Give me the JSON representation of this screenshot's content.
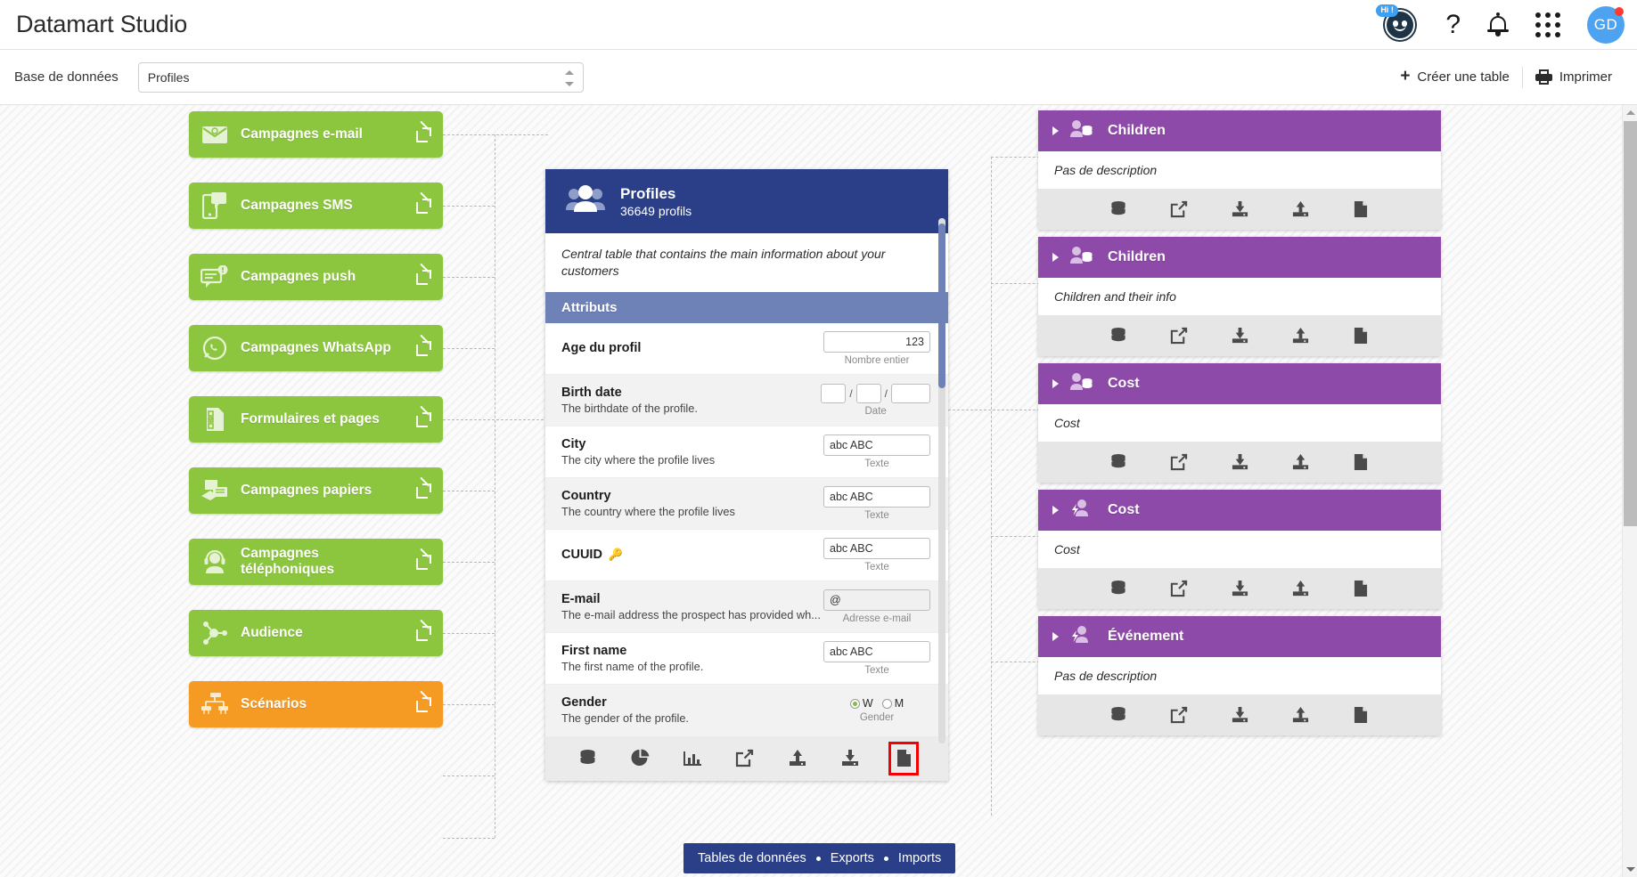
{
  "app": {
    "title": "Datamart Studio"
  },
  "header": {
    "bot_badge": "Hi !",
    "bot_icon": "chatbot-icon",
    "help_icon": "question-mark-icon",
    "bell_icon": "notification-bell-icon",
    "apps_icon": "apps-grid-icon",
    "avatar_initials": "GD"
  },
  "subheader": {
    "database_label": "Base de données",
    "database_value": "Profiles",
    "database_placeholder": "Profiles",
    "create_table_label": "Créer une table",
    "print_label": "Imprimer"
  },
  "sidebar": {
    "items": [
      {
        "label": "Campagnes e-mail",
        "icon": "envelope-icon",
        "color": "#8cc63e"
      },
      {
        "label": "Campagnes SMS",
        "icon": "mobile-sms-icon",
        "color": "#8cc63e"
      },
      {
        "label": "Campagnes push",
        "icon": "push-notification-icon",
        "color": "#8cc63e"
      },
      {
        "label": "Campagnes WhatsApp",
        "icon": "whatsapp-icon",
        "color": "#8cc63e"
      },
      {
        "label": "Formulaires et pages",
        "icon": "form-document-icon",
        "color": "#8cc63e"
      },
      {
        "label": "Campagnes papiers",
        "icon": "paper-mail-icon",
        "color": "#8cc63e"
      },
      {
        "label": "Campagnes téléphoniques",
        "icon": "headset-person-icon",
        "color": "#8cc63e"
      },
      {
        "label": "Audience",
        "icon": "network-nodes-icon",
        "color": "#8cc63e"
      },
      {
        "label": "Scénarios",
        "icon": "workflow-tree-icon",
        "color": "#f59a23"
      }
    ]
  },
  "center_card": {
    "title": "Profiles",
    "count": "36649 profils",
    "icon": "people-group-icon",
    "description": "Central table that contains the main information about your customers",
    "attributes_header": "Attributs",
    "attributes": [
      {
        "name": "Age du profil",
        "desc": "",
        "value": "123",
        "align": "right",
        "type": "Nombre entier",
        "field": "number"
      },
      {
        "name": "Birth date",
        "desc": "The birthdate of the profile.",
        "value": "",
        "type": "Date",
        "field": "date"
      },
      {
        "name": "City",
        "desc": "The city where the profile lives",
        "value": "abc ABC",
        "type": "Texte",
        "field": "text"
      },
      {
        "name": "Country",
        "desc": "The country where the profile lives",
        "value": "abc ABC",
        "type": "Texte",
        "field": "text"
      },
      {
        "name": "CUUID",
        "desc": "",
        "value": "abc ABC",
        "type": "Texte",
        "field": "text",
        "key": "🔑"
      },
      {
        "name": "E-mail",
        "desc": "The e-mail address the prospect has provided wh...",
        "value": "@",
        "type": "Adresse e-mail",
        "field": "email"
      },
      {
        "name": "First name",
        "desc": "The first name of the profile.",
        "value": "abc ABC",
        "type": "Texte",
        "field": "text"
      },
      {
        "name": "Gender",
        "desc": "The gender of the profile.",
        "value": "",
        "type": "Gender",
        "field": "radio",
        "options": [
          "W",
          "M"
        ],
        "selected": "W"
      }
    ],
    "toolbar": [
      {
        "icon": "database-icon",
        "highlighted": false
      },
      {
        "icon": "pie-chart-icon",
        "highlighted": false
      },
      {
        "icon": "bar-chart-icon",
        "highlighted": false
      },
      {
        "icon": "external-link-icon",
        "highlighted": false
      },
      {
        "icon": "upload-icon",
        "highlighted": false
      },
      {
        "icon": "download-icon",
        "highlighted": false
      },
      {
        "icon": "document-icon",
        "highlighted": true
      }
    ]
  },
  "right_cards": [
    {
      "title": "Children",
      "description": "Pas de description",
      "icon": "person-database-icon"
    },
    {
      "title": "Children",
      "description": "Children and their info",
      "icon": "person-database-icon"
    },
    {
      "title": "Cost",
      "description": "Cost",
      "icon": "person-database-icon"
    },
    {
      "title": "Cost",
      "description": "Cost",
      "icon": "person-event-icon"
    },
    {
      "title": "Événement",
      "description": "Pas de description",
      "icon": "person-event-icon"
    }
  ],
  "right_card_toolbar": [
    {
      "icon": "database-icon"
    },
    {
      "icon": "external-link-icon"
    },
    {
      "icon": "download-icon"
    },
    {
      "icon": "upload-icon"
    },
    {
      "icon": "document-icon"
    }
  ],
  "legend": {
    "items": [
      "Tables de données",
      "Exports",
      "Imports"
    ]
  },
  "colors": {
    "green": "#8cc63e",
    "orange": "#f59a23",
    "purple": "#8e4aa8",
    "navy": "#2a3f87",
    "attr_blue": "#6f82b8",
    "highlight_red": "#f40000",
    "accent_blue": "#4da3ef"
  }
}
